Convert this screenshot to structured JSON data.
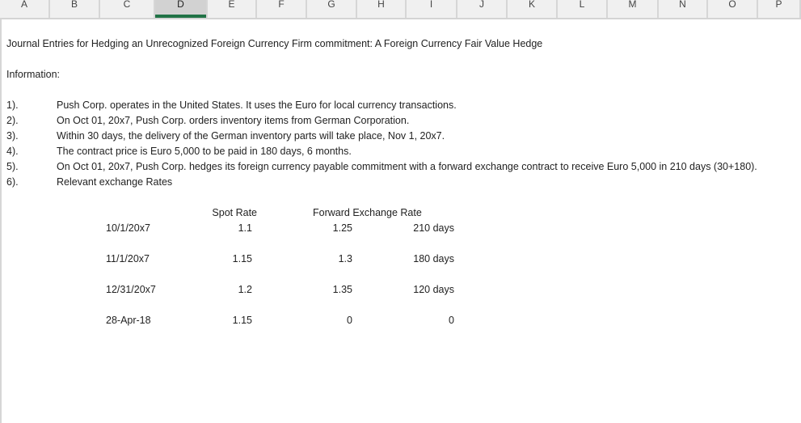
{
  "columns": [
    "A",
    "B",
    "C",
    "D",
    "E",
    "F",
    "G",
    "H",
    "I",
    "J",
    "K",
    "L",
    "M",
    "N",
    "O",
    "P"
  ],
  "selected_column": "D",
  "title": "Journal Entries for Hedging an Unrecognized Foreign Currency Firm commitment: A Foreign Currency Fair Value Hedge",
  "info_label": "Information:",
  "items": [
    {
      "num": "1).",
      "text": "Push Corp. operates in the United States. It uses the Euro for local currency transactions."
    },
    {
      "num": "2).",
      "text": "On Oct 01, 20x7, Push Corp. orders inventory items from German Corporation."
    },
    {
      "num": "3).",
      "text": "Within 30 days, the delivery of the German inventory parts will take place, Nov 1, 20x7."
    },
    {
      "num": "4).",
      "text": "The contract price is Euro 5,000 to be paid in 180 days, 6 months."
    },
    {
      "num": "5).",
      "text": "On Oct 01, 20x7, Push Corp. hedges its foreign currency payable commitment with a forward exchange contract to receive Euro 5,000 in 210 days (30+180)."
    },
    {
      "num": "6).",
      "text": "Relevant exchange Rates"
    }
  ],
  "rates": {
    "headers": {
      "spot": "Spot Rate",
      "forward": "Forward Exchange Rate"
    },
    "rows": [
      {
        "date": "10/1/20x7",
        "spot": "1.1",
        "forward": "1.25",
        "days": "210 days"
      },
      {
        "date": "11/1/20x7",
        "spot": "1.15",
        "forward": "1.3",
        "days": "180 days"
      },
      {
        "date": "12/31/20x7",
        "spot": "1.2",
        "forward": "1.35",
        "days": "120 days"
      },
      {
        "date": "28-Apr-18",
        "spot": "1.15",
        "forward": "0",
        "days": "0"
      }
    ]
  },
  "colors": {
    "accent": "#217346",
    "header_bg": "#f0f0f0",
    "selected_header_bg": "#d2d2d2"
  }
}
